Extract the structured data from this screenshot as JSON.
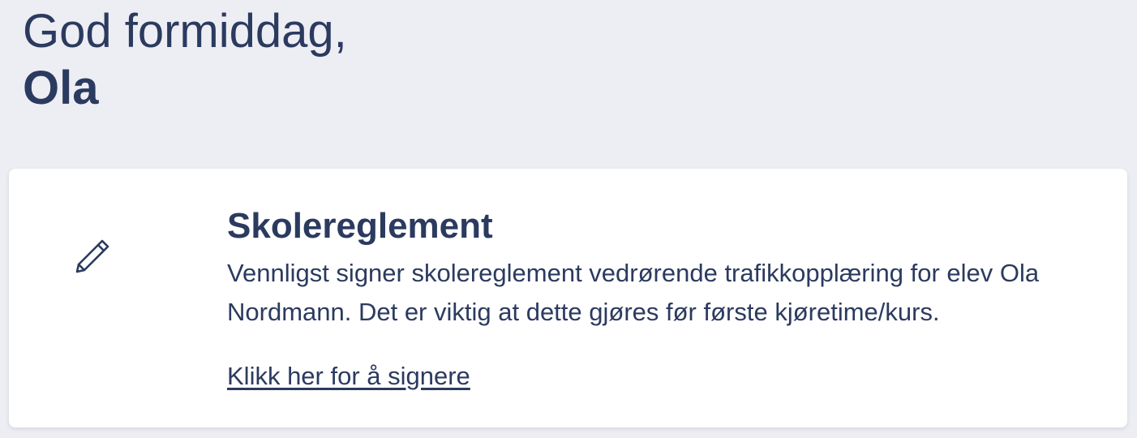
{
  "greeting": {
    "salutation": "God formiddag,",
    "name": "Ola"
  },
  "card": {
    "icon": "pencil-icon",
    "title": "Skolereglement",
    "description": "Vennligst signer skolereglement vedrørende trafikkopplæring for elev Ola Nordmann. Det er viktig at dette gjøres før første kjøretime/kurs.",
    "link_label": "Klikk her for å signere"
  },
  "colors": {
    "background": "#edeef3",
    "card": "#ffffff",
    "text": "#2b3a5f"
  }
}
